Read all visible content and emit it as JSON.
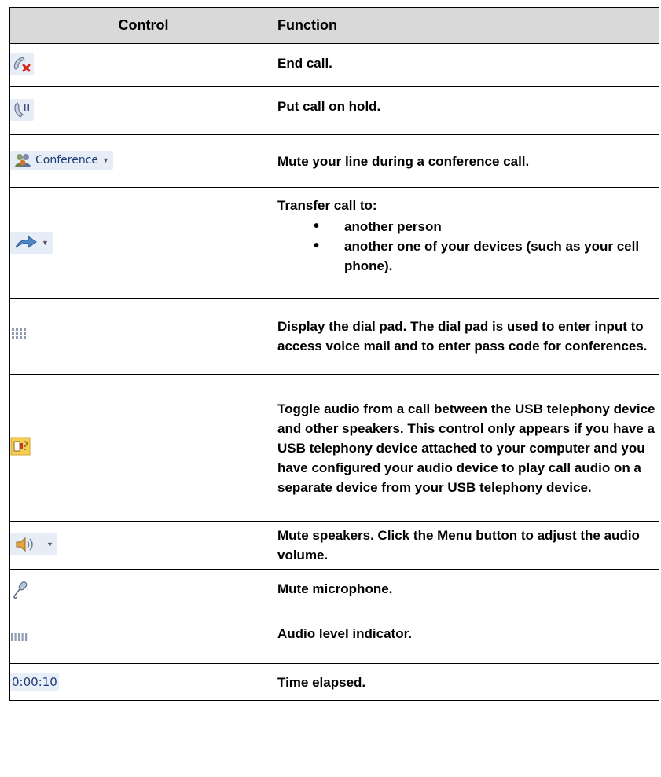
{
  "table": {
    "headers": {
      "control": "Control",
      "function": "Function"
    },
    "rows": [
      {
        "icon": "end-call-icon",
        "function": "End call."
      },
      {
        "icon": "hold-call-icon",
        "function": "Put call on hold."
      },
      {
        "icon": "conference-icon",
        "control_label": "Conference",
        "function": "Mute your line during a conference call."
      },
      {
        "icon": "transfer-arrow-icon",
        "function": "Transfer call to:",
        "options": [
          "another person",
          "another one of your devices (such as your cell phone)."
        ]
      },
      {
        "icon": "dial-pad-icon",
        "function": "Display the dial pad. The dial pad is used to enter input to access voice mail and to enter pass code for conferences."
      },
      {
        "icon": "audio-toggle-icon",
        "function": "Toggle audio from a call between the USB telephony device and other speakers. This control only appears if you have a USB telephony device attached to your computer and you have configured your audio device to play call audio on a separate device from your USB telephony device."
      },
      {
        "icon": "speaker-icon",
        "function": "Mute speakers. Click the Menu button to adjust the audio volume."
      },
      {
        "icon": "microphone-icon",
        "function": "Mute microphone."
      },
      {
        "icon": "audio-level-icon",
        "function": "Audio level indicator."
      },
      {
        "icon": "timer",
        "control_label": "0:00:10",
        "function": "Time elapsed."
      }
    ]
  }
}
